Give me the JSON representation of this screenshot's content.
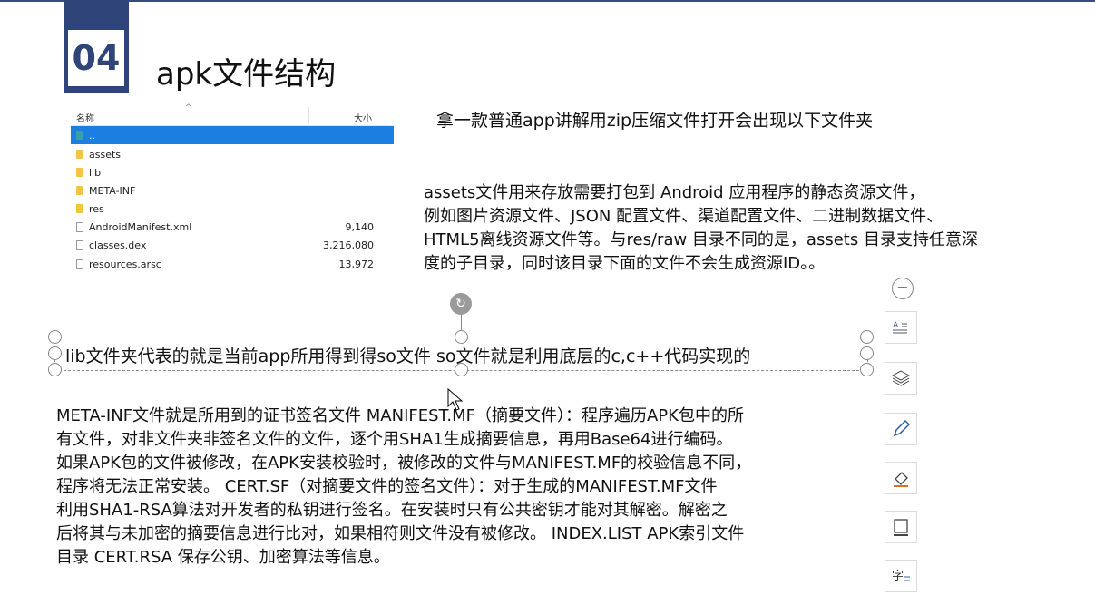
{
  "slide": {
    "number": "04",
    "title": "apk文件结构"
  },
  "explorer": {
    "header": {
      "name": "名称",
      "size": "大小"
    },
    "rows": [
      {
        "name": "..",
        "size": "",
        "type": "up",
        "selected": true
      },
      {
        "name": "assets",
        "size": "",
        "type": "folder"
      },
      {
        "name": "lib",
        "size": "",
        "type": "folder"
      },
      {
        "name": "META-INF",
        "size": "",
        "type": "folder"
      },
      {
        "name": "res",
        "size": "",
        "type": "folder"
      },
      {
        "name": "AndroidManifest.xml",
        "size": "9,140",
        "type": "file"
      },
      {
        "name": "classes.dex",
        "size": "3,216,080",
        "type": "file"
      },
      {
        "name": "resources.arsc",
        "size": "13,972",
        "type": "file"
      }
    ]
  },
  "text": {
    "intro": "拿一款普通app讲解用zip压缩文件打开会出现以下文件夹",
    "assets": [
      "assets文件用来存放需要打包到 Android 应用程序的静态资源文件，",
      "例如图片资源文件、JSON 配置文件、渠道配置文件、二进制数据文件、",
      "HTML5离线资源文件等。与res/raw 目录不同的是，assets 目录支持任意深",
      "度的子目录，同时该目录下面的文件不会生成资源ID。。"
    ],
    "lib": "lib文件夹代表的就是当前app所用得到得so文件 so文件就是利用底层的c,c++代码实现的",
    "metainf": [
      "META-INF文件就是所用到的证书签名文件   MANIFEST.MF（摘要文件）：程序遍历APK包中的所",
      "有文件，对非文件夹非签名文件的文件，逐个用SHA1生成摘要信息，再用Base64进行编码。",
      "如果APK包的文件被修改，在APK安装校验时，被修改的文件与MANIFEST.MF的校验信息不同，",
      "程序将无法正常安装。    CERT.SF（对摘要文件的签名文件）：对于生成的MANIFEST.MF文件",
      "利用SHA1-RSA算法对开发者的私钥进行签名。在安装时只有公共密钥才能对其解密。解密之",
      "后将其与未加密的摘要信息进行比对，如果相符则文件没有被修改。 INDEX.LIST APK索引文件",
      "目录   CERT.RSA   保存公钥、加密算法等信息。"
    ]
  },
  "toolbar": {
    "icons": [
      "layout-options-icon",
      "layers-icon",
      "pen-icon",
      "eraser-icon",
      "shape-icon",
      "text-format-icon"
    ]
  },
  "colors": {
    "accent": "#2f4479",
    "selection": "#1a7fe0"
  }
}
